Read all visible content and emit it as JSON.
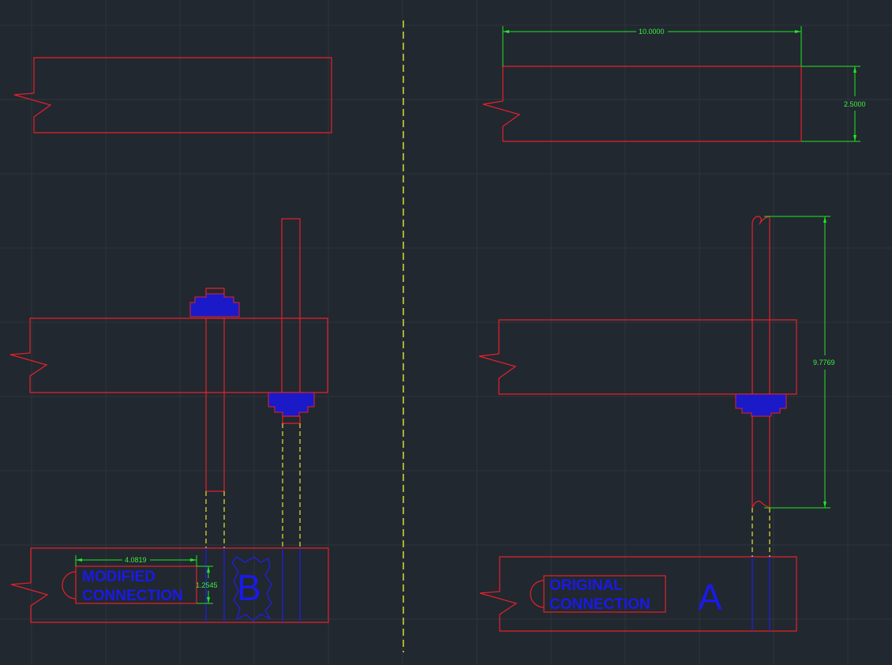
{
  "drawing": {
    "colors": {
      "background": "#212830",
      "grid": "#2d343c",
      "outline": "#e8202a",
      "hidden_line": "#e6e62a",
      "dimension": "#3cf03c",
      "annotation": "#1a1ae8"
    },
    "dimensions": {
      "beam_length": "10.0000",
      "beam_height": "2.5000",
      "bolt_length": "9.7769",
      "label_width": "4.0819",
      "label_height": "1.2545"
    },
    "labels": {
      "modified_line1": "MODIFIED",
      "modified_line2": "CONNECTION",
      "modified_letter": "B",
      "original_line1": "ORIGINAL",
      "original_line2": "CONNECTION",
      "original_letter": "A"
    }
  }
}
